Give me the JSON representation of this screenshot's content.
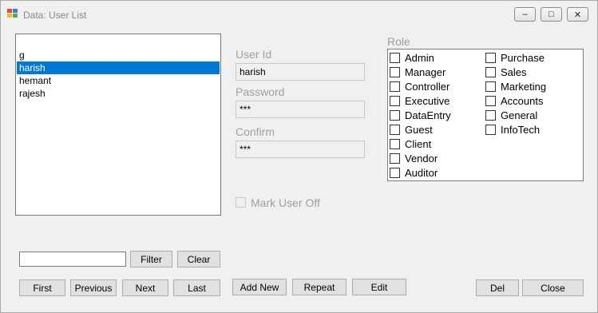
{
  "window": {
    "title": "Data: User List",
    "minimize_glyph": "–",
    "maximize_glyph": "□",
    "close_glyph": "✕"
  },
  "users": {
    "items": [
      "g",
      "harish",
      "hemant",
      "rajesh"
    ],
    "selected": "harish"
  },
  "form": {
    "user_id_label": "User Id",
    "user_id_value": "harish",
    "password_label": "Password",
    "password_value": "***",
    "confirm_label": "Confirm",
    "confirm_value": "***",
    "mark_user_off_label": "Mark User Off",
    "mark_user_off_checked": false
  },
  "roles": {
    "label": "Role",
    "left": [
      "Admin",
      "Manager",
      "Controller",
      "Executive",
      "DataEntry",
      "Guest",
      "Client",
      "Vendor",
      "Auditor"
    ],
    "right": [
      "Purchase",
      "Sales",
      "Marketing",
      "Accounts",
      "General",
      "InfoTech"
    ]
  },
  "filter": {
    "value": "",
    "filter_label": "Filter",
    "clear_label": "Clear"
  },
  "nav": {
    "first": "First",
    "previous": "Previous",
    "next": "Next",
    "last": "Last"
  },
  "actions": {
    "add_new": "Add New",
    "repeat": "Repeat",
    "edit": "Edit",
    "del": "Del",
    "close": "Close"
  },
  "colors": {
    "selection": "#0078d7",
    "disabled_text": "#a0a0a0"
  }
}
